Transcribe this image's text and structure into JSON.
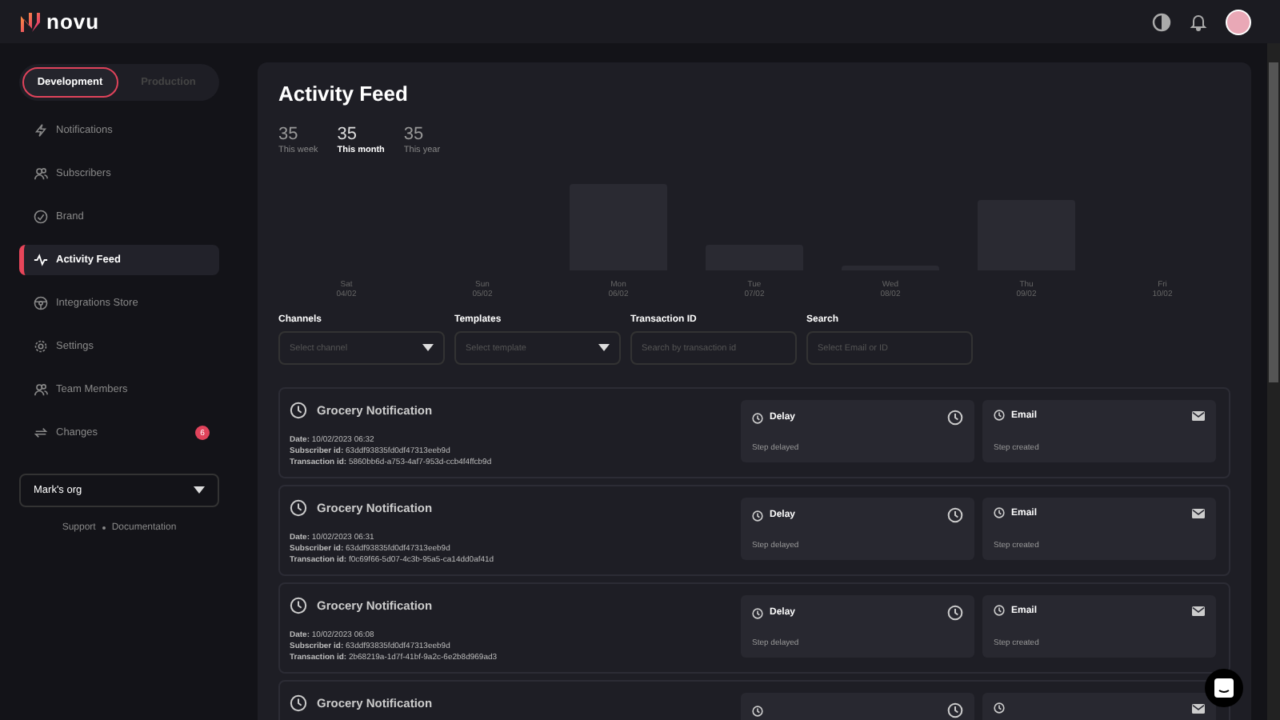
{
  "brand": {
    "name": "novu"
  },
  "environments": [
    {
      "label": "Development",
      "selected": true
    },
    {
      "label": "Production",
      "selected": false
    }
  ],
  "sidebar": {
    "items": [
      {
        "label": "Notifications",
        "kind": "bolt",
        "selected": false
      },
      {
        "label": "Subscribers",
        "kind": "users",
        "selected": false
      },
      {
        "label": "Brand",
        "kind": "check",
        "selected": false
      },
      {
        "label": "Activity Feed",
        "kind": "pulse",
        "selected": true
      },
      {
        "label": "Integrations Store",
        "kind": "wheel",
        "selected": false
      },
      {
        "label": "Settings",
        "kind": "gear",
        "selected": false
      },
      {
        "label": "Team Members",
        "kind": "users",
        "selected": false
      },
      {
        "label": "Changes",
        "kind": "swap",
        "selected": false,
        "badge": "6"
      }
    ],
    "org": "Mark's org",
    "links": [
      "Support",
      "Documentation"
    ]
  },
  "page": {
    "title": "Activity Feed",
    "stats": [
      {
        "value": "35",
        "label": "This week",
        "selected": false
      },
      {
        "value": "35",
        "label": "This month",
        "selected": true
      },
      {
        "value": "35",
        "label": "This year",
        "selected": false
      }
    ],
    "chart_days": [
      {
        "day": "Sat",
        "date": "04/02"
      },
      {
        "day": "Sun",
        "date": "05/02"
      },
      {
        "day": "Mon",
        "date": "06/02"
      },
      {
        "day": "Tue",
        "date": "07/02"
      },
      {
        "day": "Wed",
        "date": "08/02"
      },
      {
        "day": "Thu",
        "date": "09/02"
      },
      {
        "day": "Fri",
        "date": "10/02"
      }
    ],
    "filters": [
      {
        "label": "Channels",
        "placeholder": "Select channel",
        "kind": "select"
      },
      {
        "label": "Templates",
        "placeholder": "Select template",
        "kind": "select"
      },
      {
        "label": "Transaction ID",
        "placeholder": "Search by transaction id",
        "kind": "input"
      },
      {
        "label": "Search",
        "placeholder": "Select Email or ID",
        "kind": "input"
      }
    ],
    "feed": [
      {
        "title": "Grocery Notification",
        "details": [
          {
            "label": "Date:",
            "value": "10/02/2023 06:32"
          },
          {
            "label": "Subscriber id:",
            "value": "63ddf93835fd0df47313eeb9d"
          },
          {
            "label": "Transaction id:",
            "value": "5860bb6d-a753-4af7-953d-ccb4f4ffcb9d"
          }
        ],
        "steps": [
          {
            "kind": "delay",
            "name": "Delay",
            "status": "Step delayed"
          },
          {
            "kind": "email",
            "name": "Email",
            "status": "Step created"
          }
        ]
      },
      {
        "title": "Grocery Notification",
        "details": [
          {
            "label": "Date:",
            "value": "10/02/2023 06:31"
          },
          {
            "label": "Subscriber id:",
            "value": "63ddf93835fd0df47313eeb9d"
          },
          {
            "label": "Transaction id:",
            "value": "f0c69f66-5d07-4c3b-95a5-ca14dd0af41d"
          }
        ],
        "steps": [
          {
            "kind": "delay",
            "name": "Delay",
            "status": "Step delayed"
          },
          {
            "kind": "email",
            "name": "Email",
            "status": "Step created"
          }
        ]
      },
      {
        "title": "Grocery Notification",
        "details": [
          {
            "label": "Date:",
            "value": "10/02/2023 06:08"
          },
          {
            "label": "Subscriber id:",
            "value": "63ddf93835fd0df47313eeb9d"
          },
          {
            "label": "Transaction id:",
            "value": "2b68219a-1d7f-41bf-9a2c-6e2b8d969ad3"
          }
        ],
        "steps": [
          {
            "kind": "delay",
            "name": "Delay",
            "status": "Step delayed"
          },
          {
            "kind": "email",
            "name": "Email",
            "status": "Step created"
          }
        ]
      },
      {
        "title": "Grocery Notification",
        "steps": [
          {
            "kind": "delay"
          },
          {
            "kind": "email"
          }
        ]
      }
    ]
  }
}
